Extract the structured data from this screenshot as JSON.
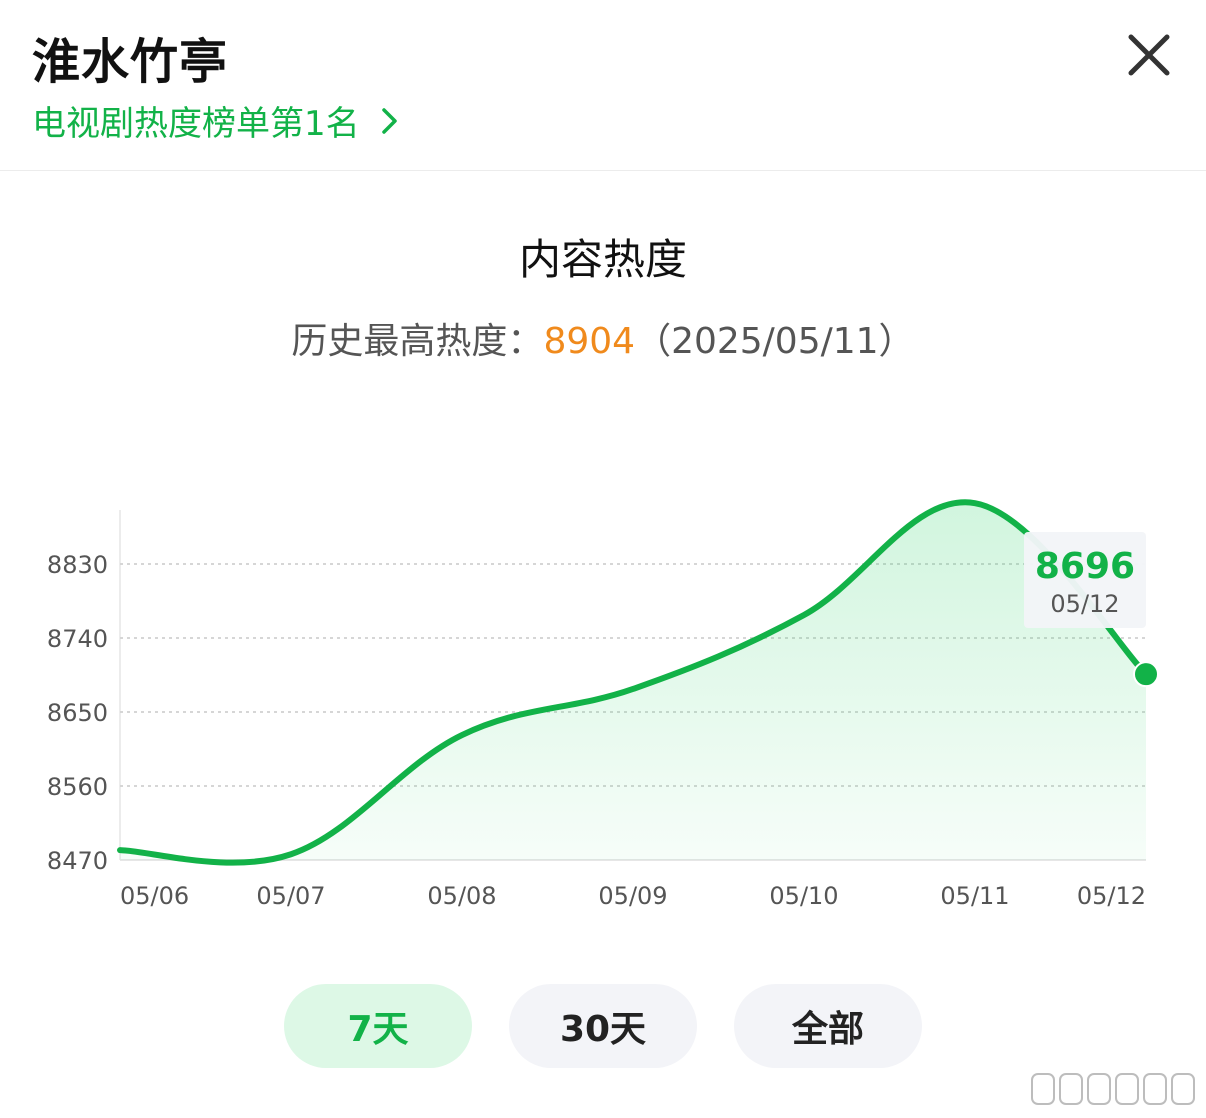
{
  "header": {
    "title": "淮水竹亭",
    "rank_link": "电视剧热度榜单第1名",
    "close_icon": "close-icon",
    "chevron_icon": "chevron-right-icon"
  },
  "section": {
    "title": "内容热度",
    "peak_label": "历史最高热度：",
    "peak_value": "8904",
    "peak_date": "（2025/05/11）"
  },
  "tooltip": {
    "value": "8696",
    "date": "05/12"
  },
  "colors": {
    "accent": "#12b248",
    "peak": "#f08a1c",
    "grid": "#d6d6d6"
  },
  "tabs": [
    {
      "label": "7天",
      "active": true
    },
    {
      "label": "30天",
      "active": false
    },
    {
      "label": "全部",
      "active": false
    }
  ],
  "chart_data": {
    "type": "area",
    "x": [
      "05/06",
      "05/07",
      "05/08",
      "05/09",
      "05/10",
      "05/11",
      "05/12"
    ],
    "y_ticks": [
      8470,
      8560,
      8650,
      8740,
      8830
    ],
    "ylim": [
      8470,
      8904
    ],
    "grid": true,
    "series": [
      {
        "values": [
          8482,
          8477,
          8622,
          8678,
          8768,
          8904,
          8696
        ]
      }
    ]
  }
}
